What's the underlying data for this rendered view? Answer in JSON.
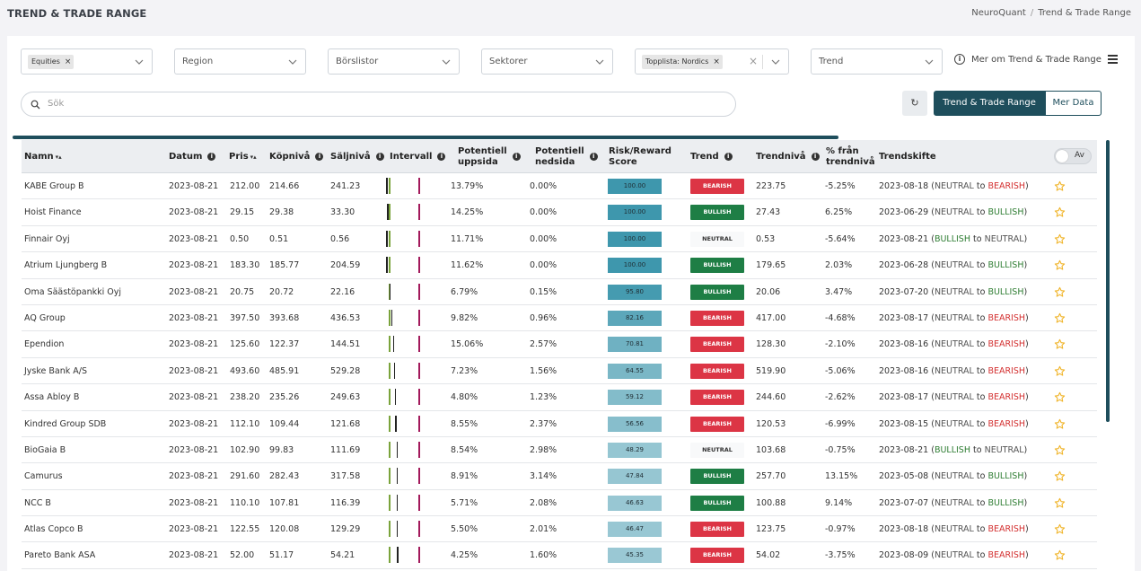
{
  "header": {
    "title": "TREND & TRADE RANGE",
    "breadcrumb": [
      "NeuroQuant",
      "/",
      "Trend & Trade Range"
    ]
  },
  "filters": {
    "equities_chip": "Equities",
    "region": "Region",
    "borslistor": "Börslistor",
    "sektorer": "Sektorer",
    "topplista_chip": "Topplista: Nordics",
    "trend": "Trend",
    "chip_remove": "×",
    "clear": "×"
  },
  "info_link": {
    "icon": "i",
    "label": "Mer om Trend & Trade Range"
  },
  "search": {
    "placeholder": "Sök"
  },
  "buttons": {
    "refresh": "↻",
    "primary": "Trend & Trade Range",
    "secondary": "Mer Data"
  },
  "table": {
    "headers": {
      "name": "Namn",
      "datum": "Datum",
      "pris": "Pris",
      "kopniva": "Köpnivå",
      "saljniva": "Säljnivå",
      "intervall": "Intervall",
      "pot_upp_1": "Potentiell",
      "pot_upp_2": "uppsida",
      "pot_ned_1": "Potentiell",
      "pot_ned_2": "nedsida",
      "rr_1": "Risk/Reward",
      "rr_2": "Score",
      "trend": "Trend",
      "trendniva": "Trendnivå",
      "fran_1": "% från",
      "fran_2": "trendnivå",
      "trendskifte": "Trendskifte",
      "info_icon": "i",
      "sort_icon": "▾▴"
    },
    "toggle_label": "Av",
    "shift_to": "to",
    "rows": [
      {
        "name": "KABE Group B",
        "date": "2023-08-21",
        "price": "212.00",
        "buy": "214.66",
        "sell": "241.23",
        "up": "13.79%",
        "down": "0.00%",
        "score": "100.00",
        "trend": "BEARISH",
        "level": "223.75",
        "from": "-5.25%",
        "shift_date": "2023-08-18",
        "shift_from": "NEUTRAL",
        "shift_to": "BEARISH"
      },
      {
        "name": "Hoist Finance",
        "date": "2023-08-21",
        "price": "29.15",
        "buy": "29.38",
        "sell": "33.30",
        "up": "14.25%",
        "down": "0.00%",
        "score": "100.00",
        "trend": "BULLISH",
        "level": "27.43",
        "from": "6.25%",
        "shift_date": "2023-06-29",
        "shift_from": "NEUTRAL",
        "shift_to": "BULLISH"
      },
      {
        "name": "Finnair Oyj",
        "date": "2023-08-21",
        "price": "0.50",
        "buy": "0.51",
        "sell": "0.56",
        "up": "11.71%",
        "down": "0.00%",
        "score": "100.00",
        "trend": "NEUTRAL",
        "level": "0.53",
        "from": "-5.64%",
        "shift_date": "2023-08-21",
        "shift_from": "BULLISH",
        "shift_to": "NEUTRAL"
      },
      {
        "name": "Atrium Ljungberg B",
        "date": "2023-08-21",
        "price": "183.30",
        "buy": "185.77",
        "sell": "204.59",
        "up": "11.62%",
        "down": "0.00%",
        "score": "100.00",
        "trend": "BULLISH",
        "level": "179.65",
        "from": "2.03%",
        "shift_date": "2023-06-28",
        "shift_from": "NEUTRAL",
        "shift_to": "BULLISH"
      },
      {
        "name": "Oma Säästöpankki Oyj",
        "date": "2023-08-21",
        "price": "20.75",
        "buy": "20.72",
        "sell": "22.16",
        "up": "6.79%",
        "down": "0.15%",
        "score": "95.80",
        "trend": "BULLISH",
        "level": "20.06",
        "from": "3.47%",
        "shift_date": "2023-07-20",
        "shift_from": "NEUTRAL",
        "shift_to": "BULLISH"
      },
      {
        "name": "AQ Group",
        "date": "2023-08-21",
        "price": "397.50",
        "buy": "393.68",
        "sell": "436.53",
        "up": "9.82%",
        "down": "0.96%",
        "score": "82.16",
        "trend": "BEARISH",
        "level": "417.00",
        "from": "-4.68%",
        "shift_date": "2023-08-17",
        "shift_from": "NEUTRAL",
        "shift_to": "BEARISH"
      },
      {
        "name": "Ependion",
        "date": "2023-08-21",
        "price": "125.60",
        "buy": "122.37",
        "sell": "144.51",
        "up": "15.06%",
        "down": "2.57%",
        "score": "70.81",
        "trend": "BEARISH",
        "level": "128.30",
        "from": "-2.10%",
        "shift_date": "2023-08-16",
        "shift_from": "NEUTRAL",
        "shift_to": "BEARISH"
      },
      {
        "name": "Jyske Bank A/S",
        "date": "2023-08-21",
        "price": "493.60",
        "buy": "485.91",
        "sell": "529.28",
        "up": "7.23%",
        "down": "1.56%",
        "score": "64.55",
        "trend": "BEARISH",
        "level": "519.90",
        "from": "-5.06%",
        "shift_date": "2023-08-16",
        "shift_from": "NEUTRAL",
        "shift_to": "BEARISH"
      },
      {
        "name": "Assa Abloy B",
        "date": "2023-08-21",
        "price": "238.20",
        "buy": "235.26",
        "sell": "249.63",
        "up": "4.80%",
        "down": "1.23%",
        "score": "59.12",
        "trend": "BEARISH",
        "level": "244.60",
        "from": "-2.62%",
        "shift_date": "2023-08-17",
        "shift_from": "NEUTRAL",
        "shift_to": "BEARISH"
      },
      {
        "name": "Kindred Group SDB",
        "date": "2023-08-21",
        "price": "112.10",
        "buy": "109.44",
        "sell": "121.68",
        "up": "8.55%",
        "down": "2.37%",
        "score": "56.56",
        "trend": "BEARISH",
        "level": "120.53",
        "from": "-6.99%",
        "shift_date": "2023-08-15",
        "shift_from": "NEUTRAL",
        "shift_to": "BEARISH"
      },
      {
        "name": "BioGaia B",
        "date": "2023-08-21",
        "price": "102.90",
        "buy": "99.83",
        "sell": "111.69",
        "up": "8.54%",
        "down": "2.98%",
        "score": "48.29",
        "trend": "NEUTRAL",
        "level": "103.68",
        "from": "-0.75%",
        "shift_date": "2023-08-21",
        "shift_from": "BULLISH",
        "shift_to": "NEUTRAL"
      },
      {
        "name": "Camurus",
        "date": "2023-08-21",
        "price": "291.60",
        "buy": "282.43",
        "sell": "317.58",
        "up": "8.91%",
        "down": "3.14%",
        "score": "47.84",
        "trend": "BULLISH",
        "level": "257.70",
        "from": "13.15%",
        "shift_date": "2023-05-08",
        "shift_from": "NEUTRAL",
        "shift_to": "BULLISH"
      },
      {
        "name": "NCC B",
        "date": "2023-08-21",
        "price": "110.10",
        "buy": "107.81",
        "sell": "116.39",
        "up": "5.71%",
        "down": "2.08%",
        "score": "46.63",
        "trend": "BULLISH",
        "level": "100.88",
        "from": "9.14%",
        "shift_date": "2023-07-07",
        "shift_from": "NEUTRAL",
        "shift_to": "BULLISH"
      },
      {
        "name": "Atlas Copco B",
        "date": "2023-08-21",
        "price": "122.55",
        "buy": "120.08",
        "sell": "129.29",
        "up": "5.50%",
        "down": "2.01%",
        "score": "46.47",
        "trend": "BEARISH",
        "level": "123.75",
        "from": "-0.97%",
        "shift_date": "2023-08-18",
        "shift_from": "NEUTRAL",
        "shift_to": "BEARISH"
      },
      {
        "name": "Pareto Bank ASA",
        "date": "2023-08-21",
        "price": "52.00",
        "buy": "51.17",
        "sell": "54.21",
        "up": "4.25%",
        "down": "1.60%",
        "score": "45.35",
        "trend": "BEARISH",
        "level": "54.02",
        "from": "-3.75%",
        "shift_date": "2023-08-09",
        "shift_from": "NEUTRAL",
        "shift_to": "BEARISH"
      }
    ]
  },
  "colors": {
    "accent": "#1e4e5c",
    "bearish": "#dc3545",
    "bullish": "#1e7e45",
    "neutral_text": "#555555",
    "shift_bullish": "#2e7d32",
    "shift_bearish": "#d32f2f",
    "star": "#f0b429"
  },
  "icons": {
    "search": "search-icon",
    "chevron": "chevron-down-icon",
    "info": "info-icon",
    "menu": "hamburger-menu-icon",
    "refresh": "refresh-icon",
    "star": "star-icon"
  }
}
